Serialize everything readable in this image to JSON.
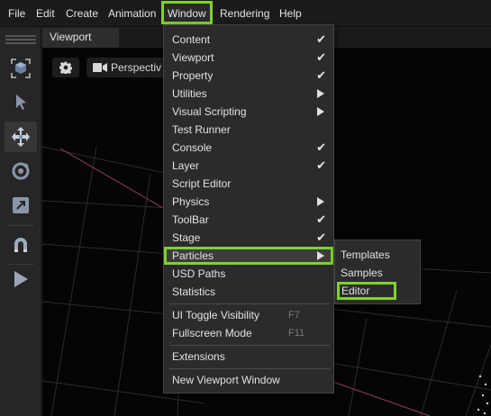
{
  "menubar": {
    "items": [
      {
        "label": "File"
      },
      {
        "label": "Edit"
      },
      {
        "label": "Create"
      },
      {
        "label": "Animation"
      },
      {
        "label": "Window",
        "active": true
      },
      {
        "label": "Rendering"
      },
      {
        "label": "Help"
      }
    ]
  },
  "toolbar": {
    "tools": [
      "select-cube-icon",
      "pointer-icon",
      "move-icon",
      "rotate-icon",
      "scale-icon",
      "snap-magnet-icon",
      "play-icon"
    ],
    "selected_tool": "move-icon"
  },
  "viewport": {
    "tab_label": "Viewport",
    "camera_label": "Perspectiv"
  },
  "window_menu": {
    "items": [
      {
        "label": "Content",
        "checked": true
      },
      {
        "label": "Viewport",
        "checked": true
      },
      {
        "label": "Property",
        "checked": true
      },
      {
        "label": "Utilities",
        "submenu": true
      },
      {
        "label": "Visual Scripting",
        "submenu": true
      },
      {
        "label": "Test Runner"
      },
      {
        "label": "Console",
        "checked": true
      },
      {
        "label": "Layer",
        "checked": true
      },
      {
        "label": "Script Editor"
      },
      {
        "label": "Physics",
        "submenu": true
      },
      {
        "label": "ToolBar",
        "checked": true
      },
      {
        "label": "Stage",
        "checked": true
      },
      {
        "label": "Particles",
        "submenu": true,
        "highlighted": true
      },
      {
        "label": "USD Paths"
      },
      {
        "label": "Statistics"
      },
      {
        "label": "UI Toggle Visibility",
        "shortcut": "F7"
      },
      {
        "label": "Fullscreen Mode",
        "shortcut": "F11"
      },
      {
        "label": "Extensions"
      },
      {
        "label": "New Viewport Window"
      }
    ]
  },
  "particles_menu": {
    "items": [
      {
        "label": "Templates"
      },
      {
        "label": "Samples"
      },
      {
        "label": "Editor",
        "highlighted": true
      }
    ]
  },
  "colors": {
    "highlight_outline": "#7dd32a",
    "menu_bg": "#2b2b2b",
    "viewport_bg": "#050505",
    "axis_line": "#7a3a44"
  }
}
